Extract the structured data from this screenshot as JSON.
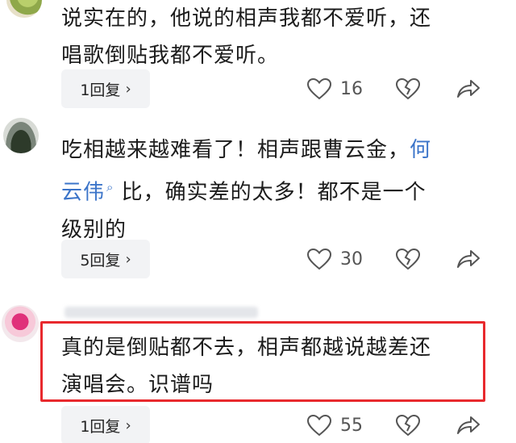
{
  "comments": [
    {
      "text_line1": "说实在的，他说的相声我都不爱听，还",
      "text_line2": "唱歌倒贴我都不爱听。",
      "reply_label": "1回复",
      "likes": "16"
    },
    {
      "text_before_link": "吃相越来越难看了！相声跟曹云金，",
      "link_text_part1": "何",
      "link_text_part2": "云伟",
      "text_after_link": " 比，确实差的太多！都不是一个",
      "text_line3": "级别的",
      "reply_label": "5回复",
      "likes": "30"
    },
    {
      "text_line1": "真的是倒贴都不去，相声都越说越差还",
      "text_line2": "演唱会。识谱吗",
      "reply_label": "1回复",
      "likes": "55"
    }
  ],
  "icons": {
    "chevron": "›",
    "like": "heart-outline-icon",
    "dislike": "broken-heart-icon",
    "share": "share-arrow-icon",
    "search": "search-icon"
  },
  "colors": {
    "link": "#3b74c9",
    "highlight": "#e8292d"
  }
}
